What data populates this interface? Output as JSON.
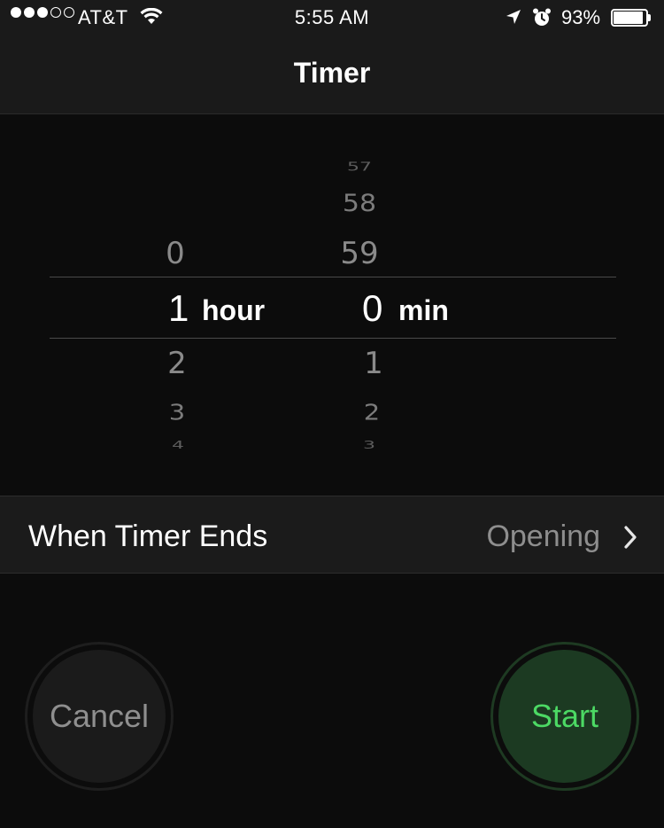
{
  "status_bar": {
    "carrier": "AT&T",
    "time": "5:55 AM",
    "battery_percent_label": "93%",
    "battery_level": 0.93,
    "signal_bars_filled": 3,
    "signal_bars_total": 5
  },
  "nav": {
    "title": "Timer"
  },
  "picker": {
    "hours": {
      "above": [
        "0"
      ],
      "selected": "1",
      "below": [
        "2",
        "3",
        "4"
      ],
      "unit": "hour"
    },
    "minutes": {
      "above": [
        "57",
        "58",
        "59"
      ],
      "selected": "0",
      "below": [
        "1",
        "2",
        "3"
      ],
      "unit": "min"
    }
  },
  "when_timer_ends": {
    "label": "When Timer Ends",
    "value": "Opening"
  },
  "buttons": {
    "cancel": "Cancel",
    "start": "Start"
  },
  "colors": {
    "start_text": "#4cd964",
    "start_bg": "#1c3a22",
    "background": "#0c0c0c"
  }
}
